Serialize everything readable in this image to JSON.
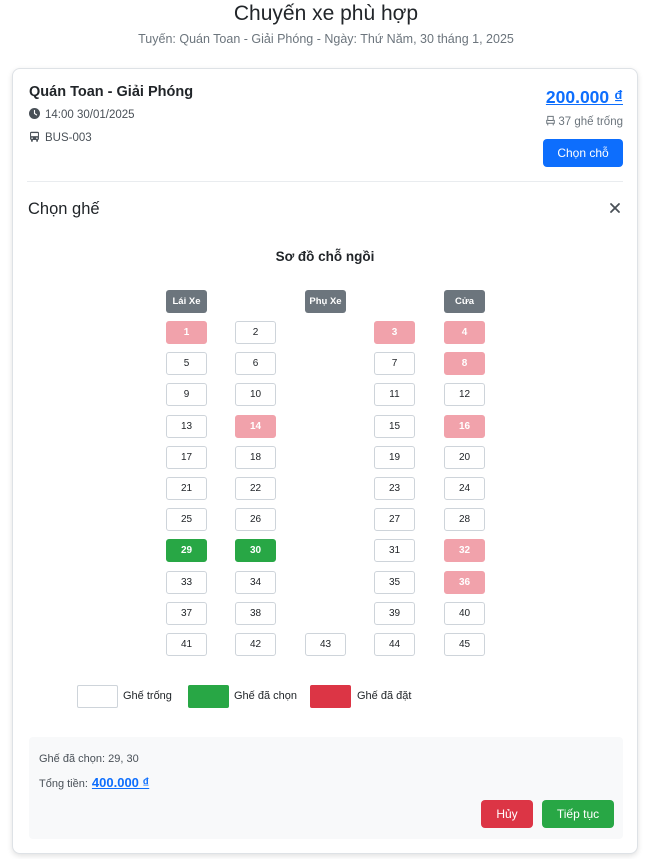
{
  "page": {
    "title": "Chuyến xe phù hợp",
    "subtitle": "Tuyến: Quán Toan - Giải Phóng - Ngày: Thứ Năm, 30 tháng 1, 2025"
  },
  "trip": {
    "route": "Quán Toan - Giải Phóng",
    "datetime": "14:00 30/01/2025",
    "bus_code": "BUS-003",
    "price": "200.000 ₫",
    "seats_left": "37 ghế trống",
    "select_button": "Chọn chỗ"
  },
  "seat_section": {
    "title": "Chọn ghế",
    "map_title": "Sơ đồ chỗ ngồi",
    "labels": {
      "driver": "Lái Xe",
      "assistant": "Phụ Xe",
      "door": "Cửa"
    },
    "seats": [
      {
        "n": "1",
        "status": "booked"
      },
      {
        "n": "2",
        "status": "empty"
      },
      {
        "n": "3",
        "status": "booked"
      },
      {
        "n": "4",
        "status": "booked"
      },
      {
        "n": "5",
        "status": "empty"
      },
      {
        "n": "6",
        "status": "empty"
      },
      {
        "n": "7",
        "status": "empty"
      },
      {
        "n": "8",
        "status": "booked"
      },
      {
        "n": "9",
        "status": "empty"
      },
      {
        "n": "10",
        "status": "empty"
      },
      {
        "n": "11",
        "status": "empty"
      },
      {
        "n": "12",
        "status": "empty"
      },
      {
        "n": "13",
        "status": "empty"
      },
      {
        "n": "14",
        "status": "booked"
      },
      {
        "n": "15",
        "status": "empty"
      },
      {
        "n": "16",
        "status": "booked"
      },
      {
        "n": "17",
        "status": "empty"
      },
      {
        "n": "18",
        "status": "empty"
      },
      {
        "n": "19",
        "status": "empty"
      },
      {
        "n": "20",
        "status": "empty"
      },
      {
        "n": "21",
        "status": "empty"
      },
      {
        "n": "22",
        "status": "empty"
      },
      {
        "n": "23",
        "status": "empty"
      },
      {
        "n": "24",
        "status": "empty"
      },
      {
        "n": "25",
        "status": "empty"
      },
      {
        "n": "26",
        "status": "empty"
      },
      {
        "n": "27",
        "status": "empty"
      },
      {
        "n": "28",
        "status": "empty"
      },
      {
        "n": "29",
        "status": "selected"
      },
      {
        "n": "30",
        "status": "selected"
      },
      {
        "n": "31",
        "status": "empty"
      },
      {
        "n": "32",
        "status": "booked"
      },
      {
        "n": "33",
        "status": "empty"
      },
      {
        "n": "34",
        "status": "empty"
      },
      {
        "n": "35",
        "status": "empty"
      },
      {
        "n": "36",
        "status": "booked"
      },
      {
        "n": "37",
        "status": "empty"
      },
      {
        "n": "38",
        "status": "empty"
      },
      {
        "n": "39",
        "status": "empty"
      },
      {
        "n": "40",
        "status": "empty"
      },
      {
        "n": "41",
        "status": "empty"
      },
      {
        "n": "42",
        "status": "empty"
      },
      {
        "n": "43",
        "status": "empty"
      },
      {
        "n": "44",
        "status": "empty"
      },
      {
        "n": "45",
        "status": "empty"
      }
    ],
    "legend": {
      "empty": "Ghế trống",
      "selected": "Ghế đã chọn",
      "booked": "Ghế đã đặt"
    }
  },
  "summary": {
    "selected_text": "Ghế đã chọn: 29, 30",
    "total_label": "Tổng tiền:",
    "total_value": "400.000 ₫",
    "cancel_button": "Hủy",
    "continue_button": "Tiếp tục"
  },
  "colors": {
    "primary": "#0d6efd",
    "selected": "#28a745",
    "booked": "#f1a2ab",
    "booked_legend": "#dc3545",
    "label_gray": "#6c757d"
  }
}
